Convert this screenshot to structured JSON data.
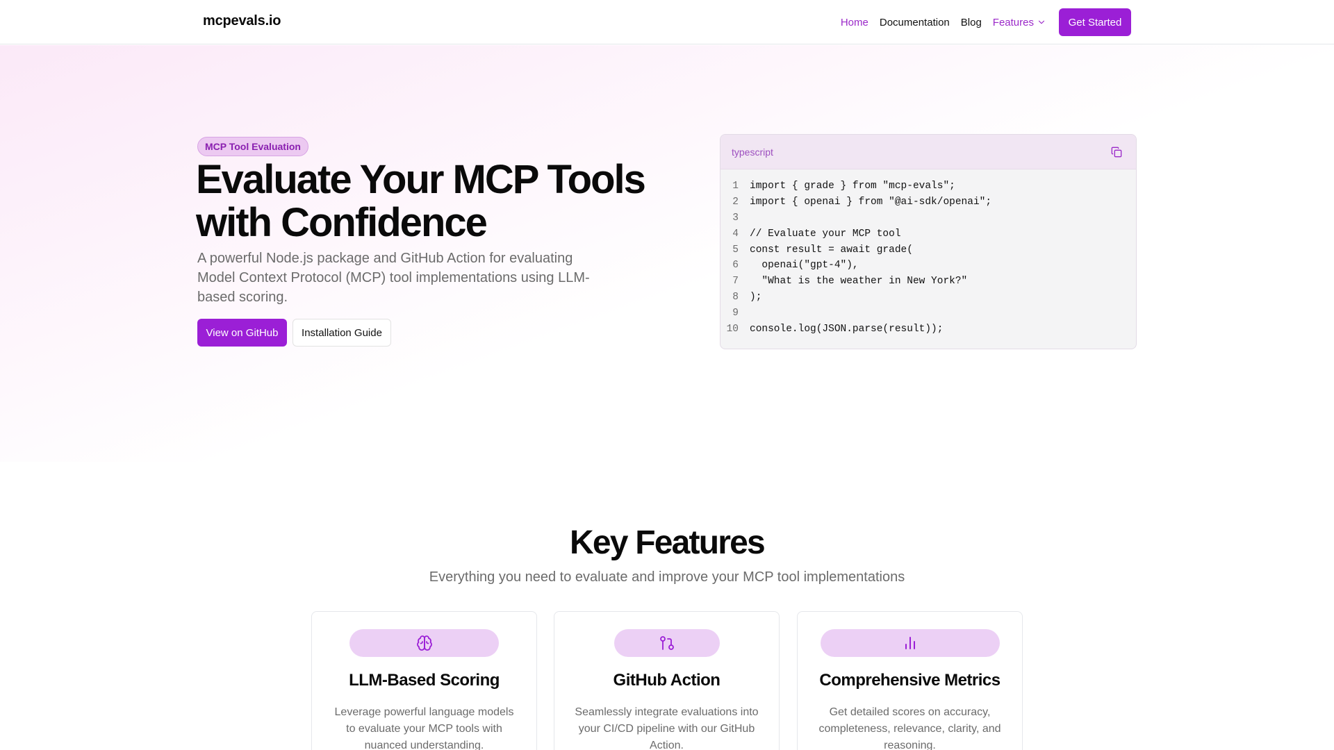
{
  "header": {
    "brand": "mcpevals.io",
    "nav": {
      "home": "Home",
      "documentation": "Documentation",
      "blog": "Blog",
      "features": "Features",
      "get_started": "Get Started"
    }
  },
  "hero": {
    "badge": "MCP Tool Evaluation",
    "title": "Evaluate Your MCP Tools with Confidence",
    "subtitle": "A powerful Node.js package and GitHub Action for evaluating Model Context Protocol (MCP) tool implementations using LLM-based scoring.",
    "buttons": {
      "github": "View on GitHub",
      "install": "Installation Guide"
    }
  },
  "code": {
    "language": "typescript",
    "lines": [
      {
        "n": "1",
        "text": "import { grade } from \"mcp-evals\";"
      },
      {
        "n": "2",
        "text": "import { openai } from \"@ai-sdk/openai\";"
      },
      {
        "n": "3",
        "text": ""
      },
      {
        "n": "4",
        "text": "// Evaluate your MCP tool"
      },
      {
        "n": "5",
        "text": "const result = await grade("
      },
      {
        "n": "6",
        "text": "  openai(\"gpt-4\"),"
      },
      {
        "n": "7",
        "text": "  \"What is the weather in New York?\""
      },
      {
        "n": "8",
        "text": ");"
      },
      {
        "n": "9",
        "text": ""
      },
      {
        "n": "10",
        "text": "console.log(JSON.parse(result));"
      }
    ]
  },
  "features": {
    "title": "Key Features",
    "subtitle": "Everything you need to evaluate and improve your MCP tool implementations",
    "cards": [
      {
        "icon": "brain-icon",
        "title": "LLM-Based Scoring",
        "description": "Leverage powerful language models to evaluate your MCP tools with nuanced understanding."
      },
      {
        "icon": "git-pull-request-icon",
        "title": "GitHub Action",
        "description": "Seamlessly integrate evaluations into your CI/CD pipeline with our GitHub Action."
      },
      {
        "icon": "bar-chart-icon",
        "title": "Comprehensive Metrics",
        "description": "Get detailed scores on accuracy, completeness, relevance, clarity, and reasoning."
      }
    ]
  },
  "colors": {
    "accent": "#9b1fd6",
    "accent_text": "#9b29c9",
    "badge_bg": "#ecc9f1",
    "pill_bg": "#ecd0f5"
  }
}
